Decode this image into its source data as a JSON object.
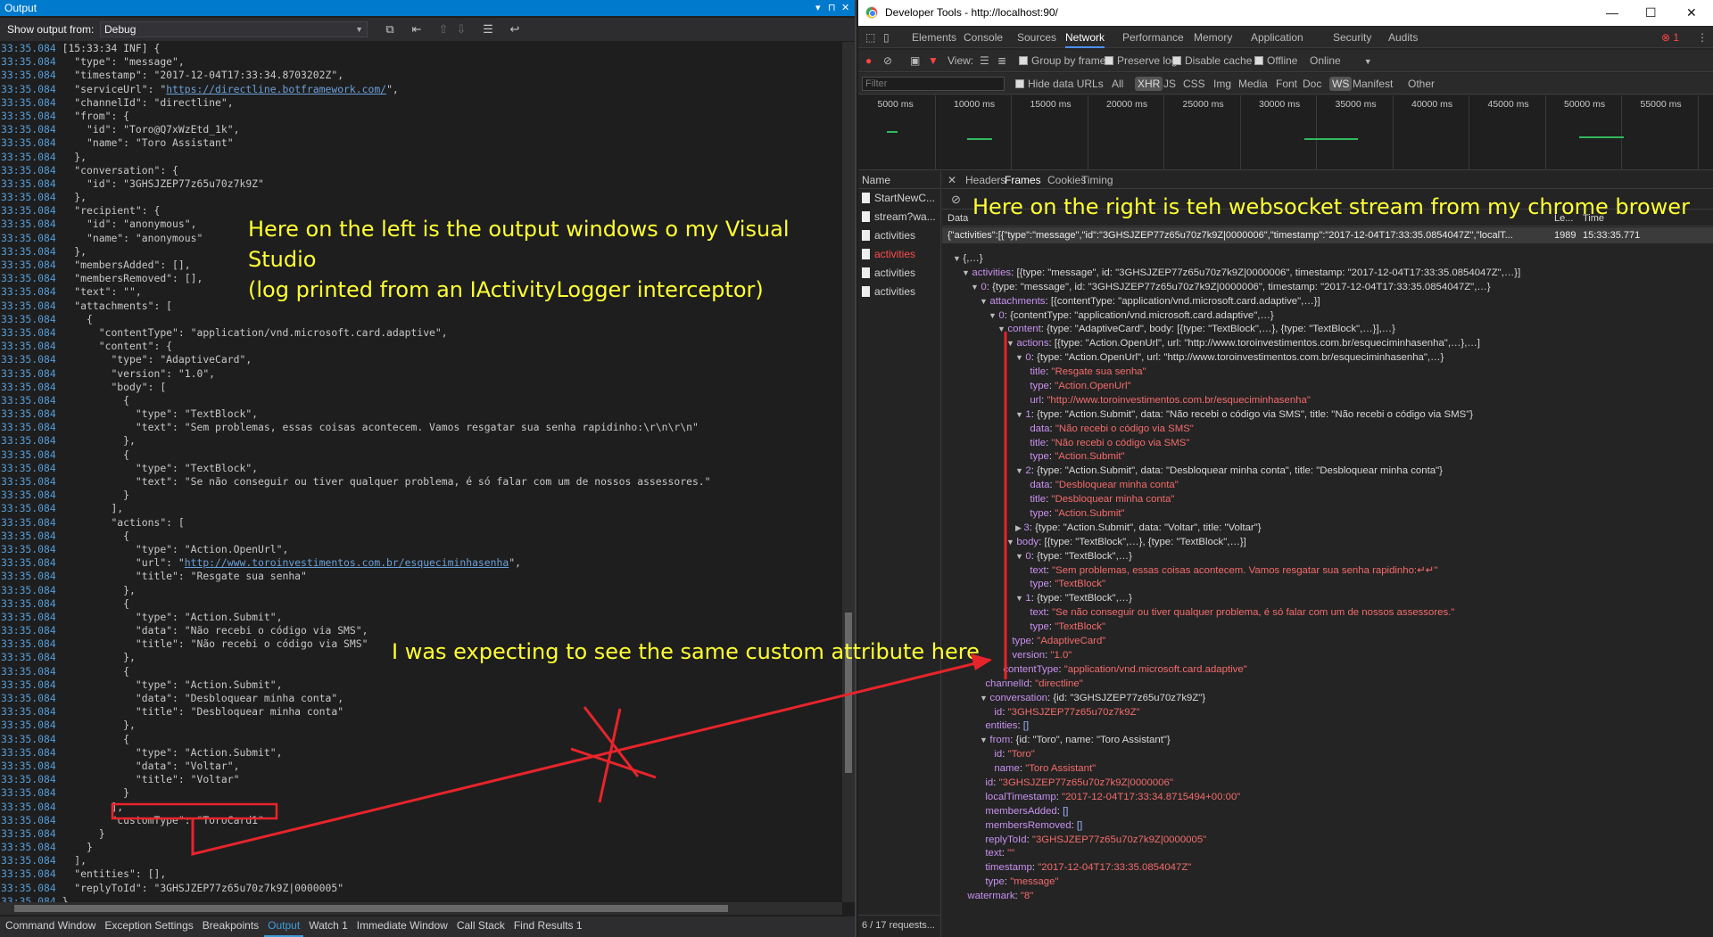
{
  "vs": {
    "title": "Output",
    "show_output_from_label": "Show output from:",
    "source_selected": "Debug",
    "bottom_tabs": [
      "Command Window",
      "Exception Settings",
      "Breakpoints",
      "Output",
      "Watch 1",
      "Immediate Window",
      "Call Stack",
      "Find Results 1"
    ],
    "active_tab": "Output",
    "timestamp": "33:35.084",
    "log_lines": [
      "[15:33:34 INF] {",
      "  \"type\": \"message\",",
      "  \"timestamp\": \"2017-12-04T17:33:34.8703202Z\",",
      "  \"serviceUrl\": \"@@https://directline.botframework.com/@@\",",
      "  \"channelId\": \"directline\",",
      "  \"from\": {",
      "    \"id\": \"Toro@Q7xWzEtd_1k\",",
      "    \"name\": \"Toro Assistant\"",
      "  },",
      "  \"conversation\": {",
      "    \"id\": \"3GHSJZEP77z65u70z7k9Z\"",
      "  },",
      "  \"recipient\": {",
      "    \"id\": \"anonymous\",",
      "    \"name\": \"anonymous\"",
      "  },",
      "  \"membersAdded\": [],",
      "  \"membersRemoved\": [],",
      "  \"text\": \"\",",
      "  \"attachments\": [",
      "    {",
      "      \"contentType\": \"application/vnd.microsoft.card.adaptive\",",
      "      \"content\": {",
      "        \"type\": \"AdaptiveCard\",",
      "        \"version\": \"1.0\",",
      "        \"body\": [",
      "          {",
      "            \"type\": \"TextBlock\",",
      "            \"text\": \"Sem problemas, essas coisas acontecem. Vamos resgatar sua senha rapidinho:\\r\\n\\r\\n\"",
      "          },",
      "          {",
      "            \"type\": \"TextBlock\",",
      "            \"text\": \"Se não conseguir ou tiver qualquer problema, é só falar com um de nossos assessores.\"",
      "          }",
      "        ],",
      "        \"actions\": [",
      "          {",
      "            \"type\": \"Action.OpenUrl\",",
      "            \"url\": \"@@http://www.toroinvestimentos.com.br/esqueciminhasenha@@\",",
      "            \"title\": \"Resgate sua senha\"",
      "          },",
      "          {",
      "            \"type\": \"Action.Submit\",",
      "            \"data\": \"Não recebi o código via SMS\",",
      "            \"title\": \"Não recebi o código via SMS\"",
      "          },",
      "          {",
      "            \"type\": \"Action.Submit\",",
      "            \"data\": \"Desbloquear minha conta\",",
      "            \"title\": \"Desbloquear minha conta\"",
      "          },",
      "          {",
      "            \"type\": \"Action.Submit\",",
      "            \"data\": \"Voltar\",",
      "            \"title\": \"Voltar\"",
      "          }",
      "        ],",
      "        \"customType\": \"ToroCard1\"",
      "      }",
      "    }",
      "  ],",
      "  \"entities\": [],",
      "  \"replyToId\": \"3GHSJZEP77z65u70z7k9Z|0000005\"",
      "}"
    ]
  },
  "devtools": {
    "window_title": "Developer Tools - http://localhost:90/",
    "tabs": [
      "Elements",
      "Console",
      "Sources",
      "Network",
      "Performance",
      "Memory",
      "Application",
      "Security",
      "Audits"
    ],
    "active_tab": "Network",
    "error_count": "1",
    "toolbar": {
      "view_label": "View:",
      "group_by_frame": "Group by frame",
      "preserve_log": "Preserve log",
      "disable_cache": "Disable cache",
      "offline": "Offline",
      "throttle": "Online"
    },
    "filterbar": {
      "filter_placeholder": "Filter",
      "hide_data_urls": "Hide data URLs",
      "types": [
        "All",
        "XHR",
        "JS",
        "CSS",
        "Img",
        "Media",
        "Font",
        "Doc",
        "WS",
        "Manifest",
        "Other"
      ]
    },
    "timeline_ticks": [
      "5000 ms",
      "10000 ms",
      "15000 ms",
      "20000 ms",
      "25000 ms",
      "30000 ms",
      "35000 ms",
      "40000 ms",
      "45000 ms",
      "50000 ms",
      "55000 ms"
    ],
    "names_header": "Name",
    "requests": [
      {
        "name": "StartNewC...",
        "error": false
      },
      {
        "name": "stream?wa...",
        "error": false
      },
      {
        "name": "activities",
        "error": false
      },
      {
        "name": "activities",
        "error": true
      },
      {
        "name": "activities",
        "error": false
      },
      {
        "name": "activities",
        "error": false
      }
    ],
    "requests_summary": "6 / 17 requests...",
    "detail_tabs": [
      "Headers",
      "Frames",
      "Cookies",
      "Timing"
    ],
    "active_detail_tab": "Frames",
    "frames_columns": [
      "Data",
      "Le...",
      "Time"
    ],
    "frame_row": {
      "data": "{\"activities\":[{\"type\":\"message\",\"id\":\"3GHSJZEP77z65u70z7k9Z|0000006\",\"timestamp\":\"2017-12-04T17:33:35.0854047Z\",\"localT...",
      "length": "1989",
      "time": "15:33:35.771"
    },
    "tree": [
      [
        0,
        "▼",
        "{,…}",
        ""
      ],
      [
        1,
        "▼",
        "activities: [{type: \"message\", id: \"3GHSJZEP77z65u70z7k9Z|0000006\", timestamp: \"2017-12-04T17:33:35.0854047Z\",…}]",
        ""
      ],
      [
        2,
        "▼",
        "0: {type: \"message\", id: \"3GHSJZEP77z65u70z7k9Z|0000006\", timestamp: \"2017-12-04T17:33:35.0854047Z\",…}",
        ""
      ],
      [
        3,
        "▼",
        "attachments: [{contentType: \"application/vnd.microsoft.card.adaptive\",…}]",
        ""
      ],
      [
        4,
        "▼",
        "0: {contentType: \"application/vnd.microsoft.card.adaptive\",…}",
        ""
      ],
      [
        5,
        "▼",
        "content: {type: \"AdaptiveCard\", body: [{type: \"TextBlock\",…}, {type: \"TextBlock\",…}],…}",
        ""
      ],
      [
        6,
        "▼",
        "actions: [{type: \"Action.OpenUrl\", url: \"http://www.toroinvestimentos.com.br/esqueciminhasenha\",…},…]",
        ""
      ],
      [
        7,
        "▼",
        "0: {type: \"Action.OpenUrl\", url: \"http://www.toroinvestimentos.com.br/esqueciminhasenha\",…}",
        ""
      ],
      [
        8,
        "",
        "title: ",
        "\"Resgate sua senha\""
      ],
      [
        8,
        "",
        "type: ",
        "\"Action.OpenUrl\""
      ],
      [
        8,
        "",
        "url: ",
        "\"http://www.toroinvestimentos.com.br/esqueciminhasenha\""
      ],
      [
        7,
        "▼",
        "1: {type: \"Action.Submit\", data: \"Não recebi o código via SMS\", title: \"Não recebi o código via SMS\"}",
        ""
      ],
      [
        8,
        "",
        "data: ",
        "\"Não recebi o código via SMS\""
      ],
      [
        8,
        "",
        "title: ",
        "\"Não recebi o código via SMS\""
      ],
      [
        8,
        "",
        "type: ",
        "\"Action.Submit\""
      ],
      [
        7,
        "▼",
        "2: {type: \"Action.Submit\", data: \"Desbloquear minha conta\", title: \"Desbloquear minha conta\"}",
        ""
      ],
      [
        8,
        "",
        "data: ",
        "\"Desbloquear minha conta\""
      ],
      [
        8,
        "",
        "title: ",
        "\"Desbloquear minha conta\""
      ],
      [
        8,
        "",
        "type: ",
        "\"Action.Submit\""
      ],
      [
        7,
        "▶",
        "3: {type: \"Action.Submit\", data: \"Voltar\", title: \"Voltar\"}",
        ""
      ],
      [
        6,
        "▼",
        "body: [{type: \"TextBlock\",…}, {type: \"TextBlock\",…}]",
        ""
      ],
      [
        7,
        "▼",
        "0: {type: \"TextBlock\",…}",
        ""
      ],
      [
        8,
        "",
        "text: ",
        "\"Sem problemas, essas coisas acontecem. Vamos resgatar sua senha rapidinho:↵↵\""
      ],
      [
        8,
        "",
        "type: ",
        "\"TextBlock\""
      ],
      [
        7,
        "▼",
        "1: {type: \"TextBlock\",…}",
        ""
      ],
      [
        8,
        "",
        "text: ",
        "\"Se não conseguir ou tiver qualquer problema, é só falar com um de nossos assessores.\""
      ],
      [
        8,
        "",
        "type: ",
        "\"TextBlock\""
      ],
      [
        6,
        "",
        "type: ",
        "\"AdaptiveCard\""
      ],
      [
        6,
        "",
        "version: ",
        "\"1.0\""
      ],
      [
        5,
        "",
        "contentType: ",
        "\"application/vnd.microsoft.card.adaptive\""
      ],
      [
        3,
        "",
        "channelId: ",
        "\"directline\""
      ],
      [
        3,
        "▼",
        "conversation: {id: \"3GHSJZEP77z65u70z7k9Z\"}",
        ""
      ],
      [
        4,
        "",
        "id: ",
        "\"3GHSJZEP77z65u70z7k9Z\""
      ],
      [
        3,
        "",
        "entities: ",
        "[]"
      ],
      [
        3,
        "▼",
        "from: {id: \"Toro\", name: \"Toro Assistant\"}",
        ""
      ],
      [
        4,
        "",
        "id: ",
        "\"Toro\""
      ],
      [
        4,
        "",
        "name: ",
        "\"Toro Assistant\""
      ],
      [
        3,
        "",
        "id: ",
        "\"3GHSJZEP77z65u70z7k9Z|0000006\""
      ],
      [
        3,
        "",
        "localTimestamp: ",
        "\"2017-12-04T17:33:34.8715494+00:00\""
      ],
      [
        3,
        "",
        "membersAdded: ",
        "[]"
      ],
      [
        3,
        "",
        "membersRemoved: ",
        "[]"
      ],
      [
        3,
        "",
        "replyToId: ",
        "\"3GHSJZEP77z65u70z7k9Z|0000005\""
      ],
      [
        3,
        "",
        "text: ",
        "\"\""
      ],
      [
        3,
        "",
        "timestamp: ",
        "\"2017-12-04T17:33:35.0854047Z\""
      ],
      [
        3,
        "",
        "type: ",
        "\"message\""
      ],
      [
        1,
        "",
        "watermark: ",
        "\"8\""
      ]
    ]
  },
  "annotations": {
    "left_note": [
      "Here on the left is the output windows o my Visual",
      "Studio",
      "(log printed from an IActivityLogger interceptor)"
    ],
    "right_note": "Here on the right is teh websocket stream from my chrome brower",
    "expect_note": "I was expecting to see the same custom attribute here"
  },
  "colors": {
    "vs_accent": "#007acc",
    "annotation_text": "#ffff33",
    "annotation_line": "#e8242b",
    "devtools_string": "#f36b6b",
    "devtools_key": "#c891f0"
  }
}
